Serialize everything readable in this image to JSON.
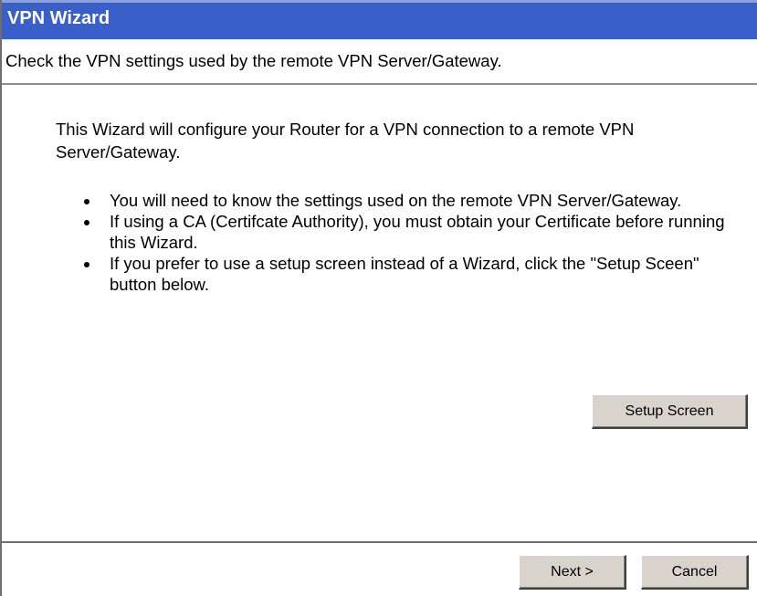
{
  "window": {
    "title": "VPN Wizard",
    "subtitle": "Check the VPN settings used by the remote VPN Server/Gateway."
  },
  "content": {
    "intro": "This Wizard will configure your Router for a VPN connection to a remote VPN Server/Gateway.",
    "bullets": [
      "You will need to know the settings used on the remote VPN Server/Gateway.",
      "If using a CA (Certifcate Authority), you must obtain your Certificate before running this Wizard.",
      "If you prefer to use a setup screen instead of a Wizard, click the \"Setup Sceen\" button below."
    ],
    "setup_button_label": "Setup Screen"
  },
  "footer": {
    "next_label": "Next >",
    "cancel_label": "Cancel"
  }
}
